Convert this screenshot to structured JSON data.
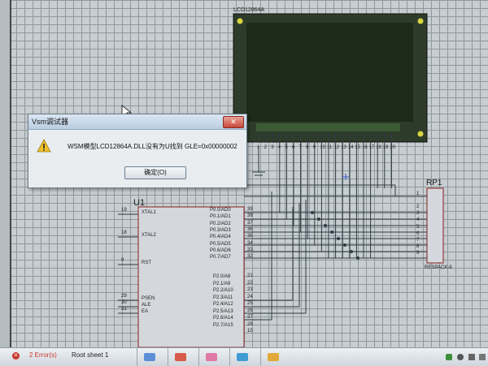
{
  "schematic": {
    "lcd": {
      "name": "LCD12864A"
    },
    "u1": {
      "name": "U1",
      "pins_left": [
        {
          "num": "19",
          "label": "XTAL1"
        },
        {
          "num": "18",
          "label": "XTAL2"
        },
        {
          "num": "9",
          "label": "RST"
        },
        {
          "num": "29",
          "label": "PSEN"
        },
        {
          "num": "30",
          "label": "ALE"
        },
        {
          "num": "31",
          "label": "EA"
        }
      ],
      "pins_p0": [
        {
          "num": "39",
          "label": "P0.0/AD0"
        },
        {
          "num": "38",
          "label": "P0.1/AD1"
        },
        {
          "num": "37",
          "label": "P0.2/AD2"
        },
        {
          "num": "36",
          "label": "P0.3/AD3"
        },
        {
          "num": "35",
          "label": "P0.4/AD4"
        },
        {
          "num": "34",
          "label": "P0.5/AD5"
        },
        {
          "num": "33",
          "label": "P0.6/AD6"
        },
        {
          "num": "32",
          "label": "P0.7/AD7"
        }
      ],
      "pins_p2": [
        {
          "num": "21",
          "label": "P2.0/A8"
        },
        {
          "num": "22",
          "label": "P2.1/A9"
        },
        {
          "num": "23",
          "label": "P2.2/A10"
        },
        {
          "num": "24",
          "label": "P2.3/A11"
        },
        {
          "num": "25",
          "label": "P2.4/A12"
        },
        {
          "num": "26",
          "label": "P2.5/A13"
        },
        {
          "num": "27",
          "label": "P2.6/A14"
        },
        {
          "num": "28",
          "label": "P2.7/A15"
        },
        {
          "num": "10",
          "label": ""
        }
      ]
    },
    "rp1": {
      "name": "RP1",
      "type": "RESPACK-8",
      "pins": [
        "1",
        "2",
        "3",
        "4",
        "5",
        "6",
        "7",
        "8",
        "9"
      ]
    },
    "lcd_pins": [
      "1",
      "2",
      "3",
      "4",
      "5",
      "6",
      "7",
      "8",
      "9",
      "10",
      "11",
      "12",
      "13",
      "14",
      "15",
      "16",
      "17",
      "18",
      "19",
      "20"
    ]
  },
  "dialog": {
    "title": "Vsm调试器",
    "close": "✕",
    "message": "WSM模型LCD12864A.DLL没有为U找到 GLE=0x00000002",
    "ok_button": "确定(O)"
  },
  "statusbar": {
    "errors": "2 Error(s)",
    "sheet": "Root sheet 1"
  },
  "colors": {
    "wire": "#2f3a44",
    "lcd_bezel": "#2d3c2a",
    "lcd_screen": "#1d2a18",
    "component_fill": "#d4d8dc",
    "component_outline": "#8a2020",
    "error": "#c8342b"
  }
}
